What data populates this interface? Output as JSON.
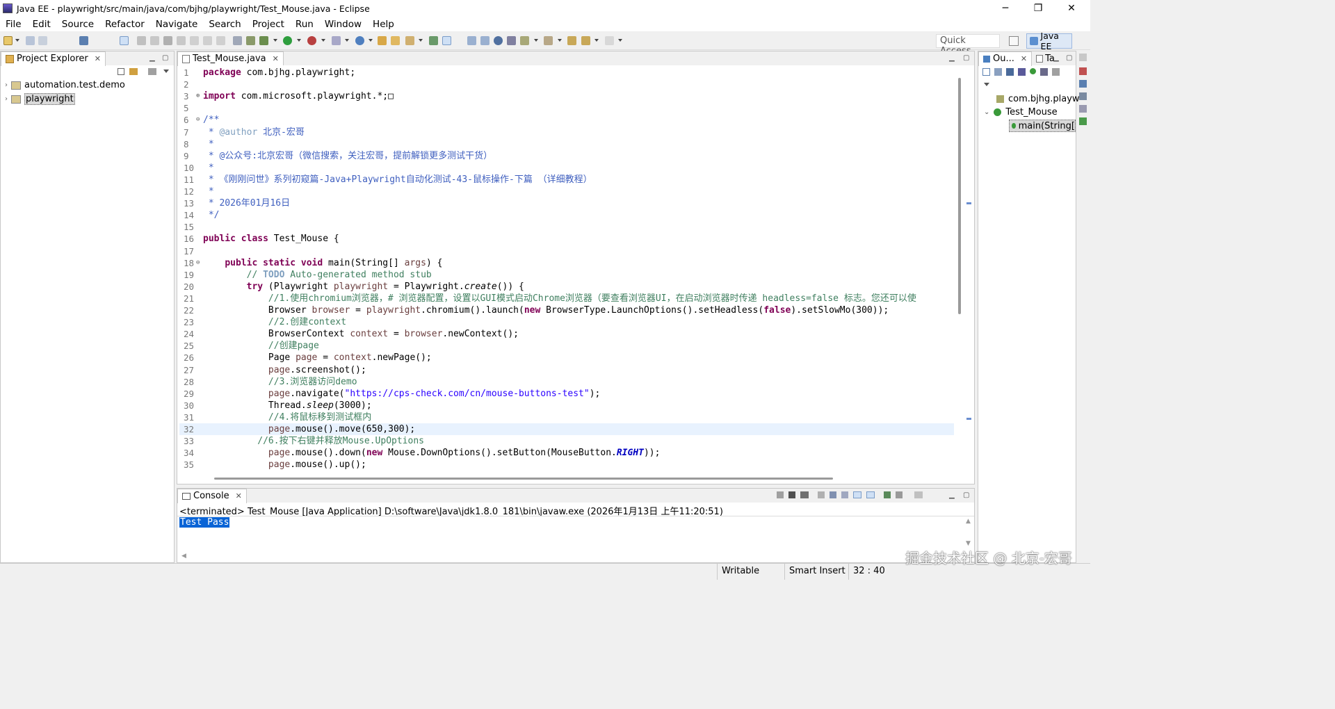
{
  "window": {
    "title": "Java EE - playwright/src/main/java/com/bjhg/playwright/Test_Mouse.java - Eclipse",
    "minimize": "─",
    "restore": "❐",
    "close": "✕"
  },
  "menu": [
    "File",
    "Edit",
    "Source",
    "Refactor",
    "Navigate",
    "Search",
    "Project",
    "Run",
    "Window",
    "Help"
  ],
  "toolbar": {
    "quick_access": "Quick Access",
    "perspective": "Java EE"
  },
  "project_explorer": {
    "title": "Project Explorer",
    "items": [
      {
        "label": "automation.test.demo",
        "selected": false
      },
      {
        "label": "playwright",
        "selected": true
      }
    ]
  },
  "editor": {
    "tab": "Test_Mouse.java",
    "lines": [
      {
        "n": "1",
        "html": "<span class='kw'>package</span> com.bjhg.playwright;"
      },
      {
        "n": "2",
        "html": ""
      },
      {
        "n": "3",
        "html": "<span class='kw'>import</span> com.microsoft.playwright.*;&#9633;",
        "fold": "plus"
      },
      {
        "n": "5",
        "html": ""
      },
      {
        "n": "6",
        "html": "<span class='cm'>/**</span>",
        "fold": "minus"
      },
      {
        "n": "7",
        "html": "<span class='cm'> * <span class='ann'>@author</span> 北京-宏哥</span>"
      },
      {
        "n": "8",
        "html": "<span class='cm'> *</span>"
      },
      {
        "n": "9",
        "html": "<span class='cm'> * @公众号:北京宏哥（微信搜索，关注宏哥，提前解锁更多测试干货）</span>"
      },
      {
        "n": "10",
        "html": "<span class='cm'> *</span>"
      },
      {
        "n": "11",
        "html": "<span class='cm'> * 《刚刚问世》系列初窥篇-Java+Playwright自动化测试-43-鼠标操作-下篇 （详细教程）</span>"
      },
      {
        "n": "12",
        "html": "<span class='cm'> *</span>"
      },
      {
        "n": "13",
        "html": "<span class='cm'> * 2026年01月16日</span>"
      },
      {
        "n": "14",
        "html": "<span class='cm'> */</span>"
      },
      {
        "n": "15",
        "html": ""
      },
      {
        "n": "16",
        "html": "<span class='kw'>public</span> <span class='kw'>class</span> Test_Mouse {"
      },
      {
        "n": "17",
        "html": ""
      },
      {
        "n": "18",
        "html": "    <span class='kw'>public</span> <span class='kw'>static</span> <span class='kw'>void</span> main(String[] <span class='var'>args</span>) {",
        "fold": "minus"
      },
      {
        "n": "19",
        "html": "        <span class='lc'>// <span style='color:#7f9fbf;font-weight:bold'>TODO</span> Auto-generated method stub</span>"
      },
      {
        "n": "20",
        "html": "        <span class='kw'>try</span> (Playwright <span class='var'>playwright</span> = Playwright.<span class='it'>create</span>()) {"
      },
      {
        "n": "21",
        "html": "            <span class='lc'>//1.使用chromium浏览器，# 浏览器配置，设置以GUI模式启动Chrome浏览器（要查看浏览器UI，在启动浏览器时传递 headless=false 标志。您还可以使</span>"
      },
      {
        "n": "22",
        "html": "            Browser <span class='var'>browser</span> = <span class='var'>playwright</span>.chromium().launch(<span class='kw'>new</span> BrowserType.LaunchOptions().setHeadless(<span class='kw'>false</span>).setSlowMo(300));"
      },
      {
        "n": "23",
        "html": "            <span class='lc'>//2.创建context</span>"
      },
      {
        "n": "24",
        "html": "            BrowserContext <span class='var'>context</span> = <span class='var'>browser</span>.newContext();"
      },
      {
        "n": "25",
        "html": "            <span class='lc'>//创建page</span>"
      },
      {
        "n": "26",
        "html": "            Page <span class='var'>page</span> = <span class='var'>context</span>.newPage();"
      },
      {
        "n": "27",
        "html": "            <span class='var'>page</span>.screenshot();"
      },
      {
        "n": "28",
        "html": "            <span class='lc'>//3.浏览器访问demo</span>"
      },
      {
        "n": "29",
        "html": "            <span class='var'>page</span>.navigate(<span class='str'>\"https://cps-check.com/cn/mouse-buttons-test\"</span>);"
      },
      {
        "n": "30",
        "html": "            Thread.<span class='it'>sleep</span>(3000);"
      },
      {
        "n": "31",
        "html": "            <span class='lc'>//4.将鼠标移到测试框内</span>"
      },
      {
        "n": "32",
        "html": "            <span class='var'>page</span>.mouse().move(650,300);",
        "current": true
      },
      {
        "n": "33",
        "html": "          <span class='lc'>//6.按下右键并释放Mouse.UpOptions</span>"
      },
      {
        "n": "34",
        "html": "            <span class='var'>page</span>.mouse().down(<span class='kw'>new</span> Mouse.DownOptions().setButton(MouseButton.<span class='fld'>RIGHT</span>));"
      },
      {
        "n": "35",
        "html": "            <span class='var'>page</span>.mouse().up();"
      }
    ]
  },
  "outline": {
    "tabs": [
      "Ou...",
      "Ta"
    ],
    "items": [
      {
        "label": "com.bjhg.playw",
        "level": 0
      },
      {
        "label": "Test_Mouse",
        "level": 0
      },
      {
        "label": "main(String[",
        "level": 1
      }
    ]
  },
  "console": {
    "title": "Console",
    "status": "<terminated> Test_Mouse [Java Application] D:\\software\\Java\\jdk1.8.0_181\\bin\\javaw.exe (2026年1月13日 上午11:20:51)",
    "output": "Test Pass"
  },
  "statusbar": {
    "writable": "Writable",
    "insert": "Smart Insert",
    "position": "32 : 40"
  },
  "watermark": "掘金技术社区 @ 北京-宏哥"
}
